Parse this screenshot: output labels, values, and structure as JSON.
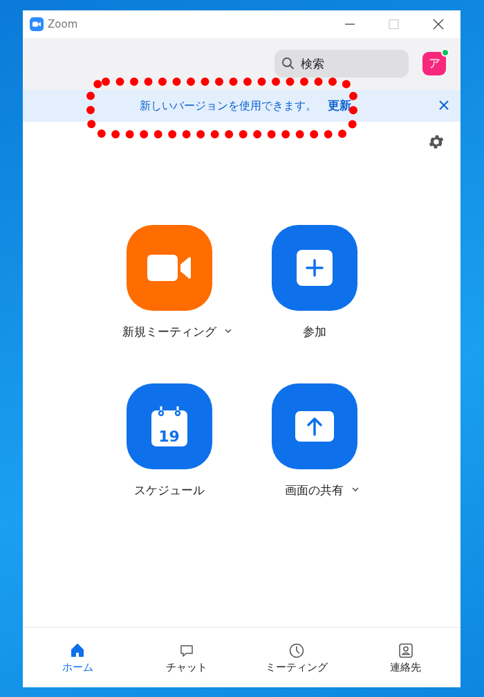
{
  "window": {
    "title": "Zoom",
    "controls": [
      {
        "kind": "minimize"
      },
      {
        "kind": "maximize"
      },
      {
        "kind": "close"
      }
    ]
  },
  "header": {
    "search": {
      "placeholder": "検索"
    },
    "avatar": {
      "initial": "ア",
      "color": "#f7287c",
      "online": true
    }
  },
  "banner": {
    "message": "新しいバージョンを使用できます。",
    "link": "更新",
    "closable": true
  },
  "annotation": {
    "kind": "dotted-outline",
    "color": "#ff0000"
  },
  "settings": {
    "kind": "gear"
  },
  "tiles": [
    {
      "kind": "video",
      "label": "新規ミーティング",
      "color": "#ff6c00",
      "dropdown": true
    },
    {
      "kind": "plus",
      "label": "参加",
      "color": "#0e71eb",
      "dropdown": false
    },
    {
      "kind": "calendar",
      "label": "スケジュール",
      "color": "#0e71eb",
      "dropdown": false,
      "day": "19"
    },
    {
      "kind": "share",
      "label": "画面の共有",
      "color": "#0e71eb",
      "dropdown": true
    }
  ],
  "tabs": [
    {
      "kind": "home",
      "label": "ホーム",
      "selected": true
    },
    {
      "kind": "chat",
      "label": "チャット",
      "selected": false
    },
    {
      "kind": "clock",
      "label": "ミーティング",
      "selected": false
    },
    {
      "kind": "contact",
      "label": "連絡先",
      "selected": false
    }
  ]
}
